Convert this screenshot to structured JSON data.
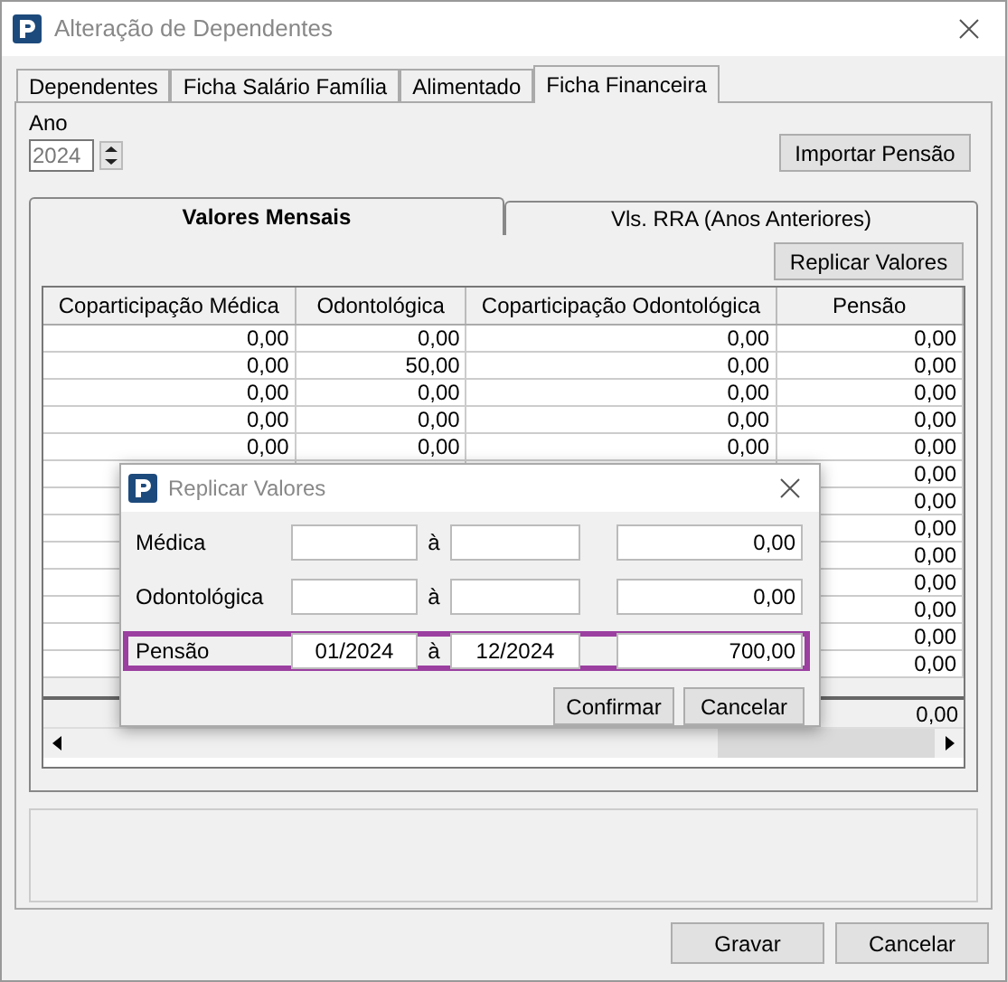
{
  "window": {
    "title": "Alteração de Dependentes"
  },
  "tabs": [
    {
      "label": "Dependentes",
      "selected": false
    },
    {
      "label": "Ficha Salário Família",
      "selected": false
    },
    {
      "label": "Alimentado",
      "selected": false
    },
    {
      "label": "Ficha Financeira",
      "selected": true
    }
  ],
  "year": {
    "label": "Ano",
    "value": "2024",
    "disabled": true
  },
  "import_button": "Importar Pensão",
  "inner_tabs": [
    {
      "label": "Valores Mensais",
      "selected": true
    },
    {
      "label": "Vls. RRA (Anos Anteriores)",
      "selected": false
    }
  ],
  "replicate_button": "Replicar Valores",
  "table": {
    "columns": [
      "Coparticipação Médica",
      "Odontológica",
      "Coparticipação Odontológica",
      "Pensão"
    ],
    "rows": [
      {
        "coparticipacao_medica": "0,00",
        "odontologica": "0,00",
        "coparticipacao_odontologica": "0,00",
        "pensao": "0,00"
      },
      {
        "coparticipacao_medica": "0,00",
        "odontologica": "50,00",
        "coparticipacao_odontologica": "0,00",
        "pensao": "0,00"
      },
      {
        "coparticipacao_medica": "0,00",
        "odontologica": "0,00",
        "coparticipacao_odontologica": "0,00",
        "pensao": "0,00"
      },
      {
        "coparticipacao_medica": "0,00",
        "odontologica": "0,00",
        "coparticipacao_odontologica": "0,00",
        "pensao": "0,00"
      },
      {
        "coparticipacao_medica": "0,00",
        "odontologica": "0,00",
        "coparticipacao_odontologica": "0,00",
        "pensao": "0,00"
      },
      {
        "pensao": "0,00"
      },
      {
        "pensao": "0,00"
      },
      {
        "pensao": "0,00"
      },
      {
        "pensao": "0,00"
      },
      {
        "pensao": "0,00"
      },
      {
        "pensao": "0,00"
      },
      {
        "pensao": "0,00"
      },
      {
        "pensao": "0,00"
      }
    ],
    "totals": {
      "pensao": "0,00"
    }
  },
  "dialog": {
    "title": "Replicar Valores",
    "rows": [
      {
        "label": "Médica",
        "separator": "à",
        "value": "0,00",
        "highlighted": false
      },
      {
        "label": "Odontológica",
        "separator": "à",
        "value": "0,00",
        "highlighted": false
      },
      {
        "label": "Pensão",
        "from": "01/2024",
        "separator": "à",
        "to": "12/2024",
        "value": "700,00",
        "highlighted": true
      }
    ],
    "buttons": [
      "Confirmar",
      "Cancelar"
    ]
  },
  "buttons": [
    "Gravar",
    "Cancelar"
  ]
}
